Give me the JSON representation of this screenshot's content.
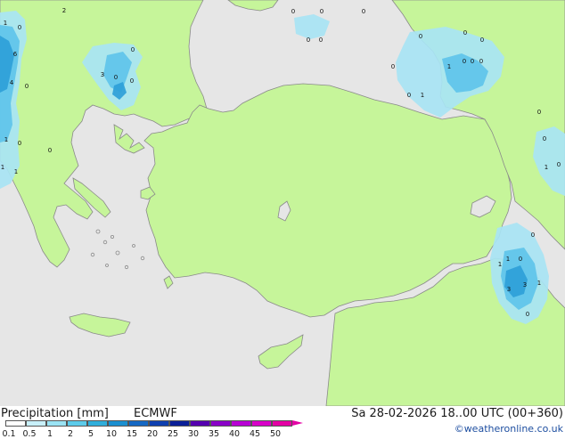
{
  "footer": {
    "title": "Precipitation [mm]",
    "model": "ECMWF",
    "datetime": "Sa 28-02-2026 18..00 UTC (00+360)",
    "credit": "©weatheronline.co.uk"
  },
  "colorbar": {
    "labels": [
      "0.1",
      "0.5",
      "1",
      "2",
      "5",
      "10",
      "15",
      "20",
      "25",
      "30",
      "35",
      "40",
      "45",
      "50"
    ],
    "colors": [
      "#ffffff",
      "#c8f0fa",
      "#9ae3f4",
      "#5ccbea",
      "#30aedb",
      "#1b8fd0",
      "#1568c4",
      "#0e3fb0",
      "#0a1f98",
      "#5500b0",
      "#8a00c8",
      "#b800d4",
      "#d800c8",
      "#e400a4"
    ]
  },
  "map": {
    "colors": {
      "sea": "#e6e6e6",
      "land": "#c6f59a",
      "coast": "#8a8a8a",
      "precip_light": "#a8e4f4",
      "precip_medium": "#5ec4ea",
      "precip_heavy": "#2e9fd8"
    },
    "value_labels": [
      "2",
      "1",
      "0",
      "0",
      "0",
      "0",
      "0",
      "0",
      "6",
      "4",
      "0",
      "0",
      "3",
      "0",
      "0",
      "1",
      "0",
      "0",
      "1",
      "1",
      "1",
      "0",
      "0",
      "0",
      "1",
      "0",
      "0",
      "0",
      "0",
      "0",
      "0",
      "0",
      "0",
      "1",
      "0",
      "1",
      "0",
      "1",
      "3",
      "3",
      "1",
      "0"
    ]
  }
}
